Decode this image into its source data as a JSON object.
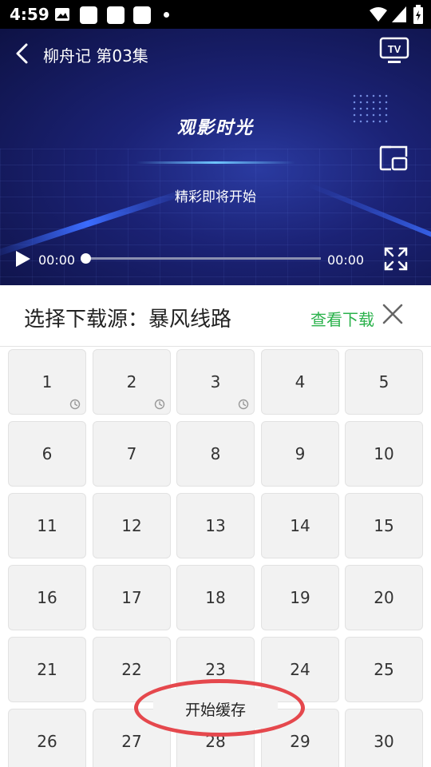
{
  "status_bar": {
    "time": "4:59"
  },
  "player": {
    "title": "柳舟记 第03集",
    "logo_text": "观影时光",
    "loading_text": "精彩即将开始",
    "current_time": "00:00",
    "total_time": "00:00",
    "progress": 0
  },
  "panel": {
    "title": "选择下载源：暴风线路",
    "view_downloads": "查看下载"
  },
  "episodes": [
    {
      "label": "1",
      "queued": true
    },
    {
      "label": "2",
      "queued": true
    },
    {
      "label": "3",
      "queued": true
    },
    {
      "label": "4",
      "queued": false
    },
    {
      "label": "5",
      "queued": false
    },
    {
      "label": "6",
      "queued": false
    },
    {
      "label": "7",
      "queued": false
    },
    {
      "label": "8",
      "queued": false
    },
    {
      "label": "9",
      "queued": false
    },
    {
      "label": "10",
      "queued": false
    },
    {
      "label": "11",
      "queued": false
    },
    {
      "label": "12",
      "queued": false
    },
    {
      "label": "13",
      "queued": false
    },
    {
      "label": "14",
      "queued": false
    },
    {
      "label": "15",
      "queued": false
    },
    {
      "label": "16",
      "queued": false
    },
    {
      "label": "17",
      "queued": false
    },
    {
      "label": "18",
      "queued": false
    },
    {
      "label": "19",
      "queued": false
    },
    {
      "label": "20",
      "queued": false
    },
    {
      "label": "21",
      "queued": false
    },
    {
      "label": "22",
      "queued": false
    },
    {
      "label": "23",
      "queued": false
    },
    {
      "label": "24",
      "queued": false
    },
    {
      "label": "25",
      "queued": false
    },
    {
      "label": "26",
      "queued": false
    },
    {
      "label": "27",
      "queued": false
    },
    {
      "label": "28",
      "queued": false
    },
    {
      "label": "29",
      "queued": false
    },
    {
      "label": "30",
      "queued": false
    }
  ],
  "start_cache_button": "开始缓存",
  "colors": {
    "accent_green": "#2bb24c",
    "highlight_red": "#e5484d",
    "player_bg": "#1b2275"
  }
}
